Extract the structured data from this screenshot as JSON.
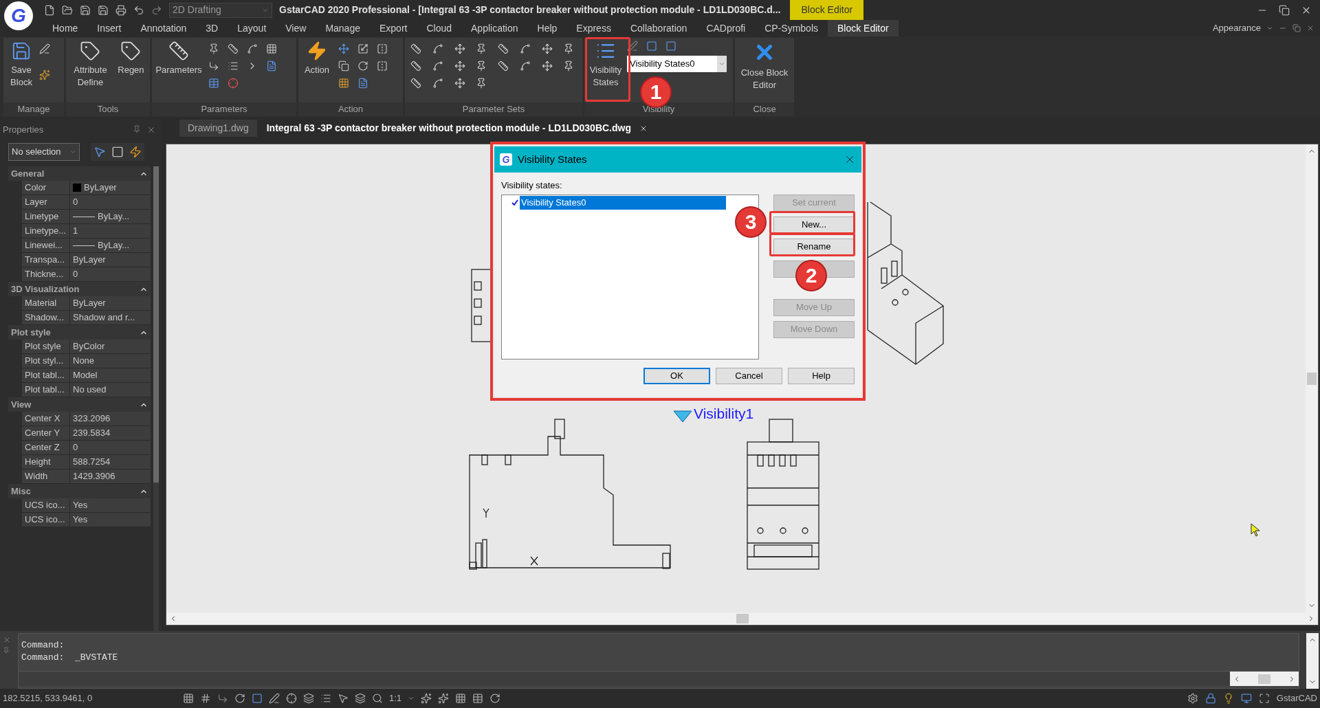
{
  "title_bar": {
    "logo_letter": "G",
    "workspace": "2D Drafting",
    "title": "GstarCAD 2020 Professional - [Integral 63 -3P contactor breaker without protection module - LD1LD030BC.d...",
    "context_tab": "Block Editor"
  },
  "menu_tabs": [
    {
      "label": "Home",
      "selected": false
    },
    {
      "label": "Insert",
      "selected": false
    },
    {
      "label": "Annotation",
      "selected": false
    },
    {
      "label": "3D",
      "selected": false
    },
    {
      "label": "Layout",
      "selected": false
    },
    {
      "label": "View",
      "selected": false
    },
    {
      "label": "Manage",
      "selected": false
    },
    {
      "label": "Export",
      "selected": false
    },
    {
      "label": "Cloud",
      "selected": false
    },
    {
      "label": "Application",
      "selected": false
    },
    {
      "label": "Help",
      "selected": false
    },
    {
      "label": "Express",
      "selected": false
    },
    {
      "label": "Collaboration",
      "selected": false
    },
    {
      "label": "CADprofi",
      "selected": false
    },
    {
      "label": "CP-Symbols",
      "selected": false
    },
    {
      "label": "Block Editor",
      "selected": true
    }
  ],
  "appearance": "Appearance",
  "ribbon": [
    {
      "kind": "manage",
      "title": "Manage",
      "buttons": [
        "Save Block"
      ]
    },
    {
      "kind": "tools",
      "title": "Tools",
      "buttons": [
        "Attribute Define",
        "Regen"
      ]
    },
    {
      "kind": "parameters",
      "title": "Parameters",
      "buttons": [
        "Parameters"
      ]
    },
    {
      "kind": "action",
      "title": "Action",
      "buttons": [
        "Action"
      ]
    },
    {
      "kind": "parameter_sets",
      "title": "Parameter Sets"
    },
    {
      "kind": "visibility",
      "title": "Visibility",
      "buttons": [
        "Visibility States"
      ],
      "dropdown": "Visibility States0"
    },
    {
      "kind": "close",
      "title": "Close",
      "buttons": [
        "Close Block Editor"
      ]
    }
  ],
  "properties": {
    "title": "Properties",
    "selection": "No selection",
    "sections": [
      {
        "title": "General",
        "expanded": true,
        "rows": [
          {
            "kind": "swatch",
            "label": "Color",
            "value": "ByLayer"
          },
          {
            "kind": "plain",
            "label": "Layer",
            "value": "0"
          },
          {
            "kind": "line",
            "label": "Linetype",
            "value": "ByLay..."
          },
          {
            "kind": "plain",
            "label": "Linetype...",
            "value": "1"
          },
          {
            "kind": "line",
            "label": "Linewei...",
            "value": "ByLay..."
          },
          {
            "kind": "plain",
            "label": "Transpa...",
            "value": "ByLayer"
          },
          {
            "kind": "plain",
            "label": "Thickne...",
            "value": "0"
          }
        ]
      },
      {
        "title": "3D Visualization",
        "expanded": true,
        "rows": [
          {
            "kind": "plain",
            "label": "Material",
            "value": "ByLayer"
          },
          {
            "kind": "plain",
            "label": "Shadow...",
            "value": "Shadow and r..."
          }
        ]
      },
      {
        "title": "Plot style",
        "expanded": true,
        "rows": [
          {
            "kind": "plain",
            "label": "Plot style",
            "value": "ByColor"
          },
          {
            "kind": "plain",
            "label": "Plot styl...",
            "value": "None"
          },
          {
            "kind": "plain",
            "label": "Plot tabl...",
            "value": "Model"
          },
          {
            "kind": "plain",
            "label": "Plot tabl...",
            "value": "No used"
          }
        ]
      },
      {
        "title": "View",
        "expanded": true,
        "rows": [
          {
            "kind": "plain",
            "label": "Center X",
            "value": "323.2096"
          },
          {
            "kind": "plain",
            "label": "Center Y",
            "value": "239.5834"
          },
          {
            "kind": "plain",
            "label": "Center Z",
            "value": "0"
          },
          {
            "kind": "plain",
            "label": "Height",
            "value": "588.7254"
          },
          {
            "kind": "plain",
            "label": "Width",
            "value": "1429.3906"
          }
        ]
      },
      {
        "title": "Misc",
        "expanded": true,
        "rows": [
          {
            "kind": "plain",
            "label": "UCS ico...",
            "value": "Yes"
          },
          {
            "kind": "plain",
            "label": "UCS ico...",
            "value": "Yes"
          }
        ]
      }
    ]
  },
  "doc_tabs": [
    {
      "label": "Drawing1.dwg",
      "selected": false
    },
    {
      "label": "Integral 63 -3P contactor breaker without protection module - LD1LD030BC.dwg",
      "selected": true
    }
  ],
  "canvas": {
    "parameter_label": "Visibility1"
  },
  "dialog": {
    "icon_letter": "G",
    "title": "Visibility States",
    "list_label": "Visibility states:",
    "states": [
      {
        "name": "Visibility States0",
        "selected": true,
        "current": true
      }
    ],
    "edit_buttons": [
      {
        "kind": "button",
        "label": "Set current",
        "disabled": true
      },
      {
        "kind": "button",
        "label": "New...",
        "disabled": false
      },
      {
        "kind": "button",
        "label": "Rename",
        "disabled": false
      },
      {
        "kind": "covered",
        "disabled": true
      }
    ],
    "order_buttons": [
      {
        "label": "Move Up",
        "disabled": true
      },
      {
        "label": "Move Down",
        "disabled": true
      }
    ],
    "footer_buttons": [
      {
        "label": "OK",
        "default": true
      },
      {
        "label": "Cancel",
        "default": false
      },
      {
        "label": "Help",
        "default": false
      }
    ]
  },
  "callouts": [
    {
      "number": "1"
    },
    {
      "number": "2"
    },
    {
      "number": "3"
    }
  ],
  "command": {
    "lines": [
      "Command:",
      "Command:  _BVSTATE"
    ]
  },
  "status_bar": {
    "coordinates": "182.5215, 533.9461, 0",
    "scale": "1:1",
    "brand": "GstarCAD"
  }
}
